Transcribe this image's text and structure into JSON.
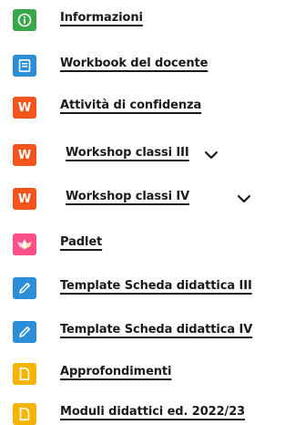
{
  "menu": {
    "items": [
      {
        "label": "Informazioni",
        "icon": "info-icon",
        "color": "#3aa84a"
      },
      {
        "label": "Workbook del docente",
        "icon": "document-icon",
        "color": "#2a8fd8"
      },
      {
        "label": "Attività di confidenza",
        "icon": "wordwall-icon",
        "color": "#f2541b"
      },
      {
        "label": "Workshop classi III",
        "icon": "wordwall-icon",
        "color": "#f2541b"
      },
      {
        "label": "Workshop classi IV",
        "icon": "wordwall-icon",
        "color": "#f2541b"
      },
      {
        "label": "Padlet",
        "icon": "padlet-icon",
        "color": "#ff4f8b"
      },
      {
        "label": "Template Scheda didattica III",
        "icon": "pencil-icon",
        "color": "#2a8fd8"
      },
      {
        "label": "Template Scheda didattica IV",
        "icon": "pencil-icon",
        "color": "#2a8fd8"
      },
      {
        "label": "Approfondimenti",
        "icon": "file-icon",
        "color": "#f5b400"
      },
      {
        "label": "Moduli didattici ed. 2022/23",
        "icon": "file-icon",
        "color": "#f5b400"
      }
    ],
    "wordwall_letter": "W"
  }
}
